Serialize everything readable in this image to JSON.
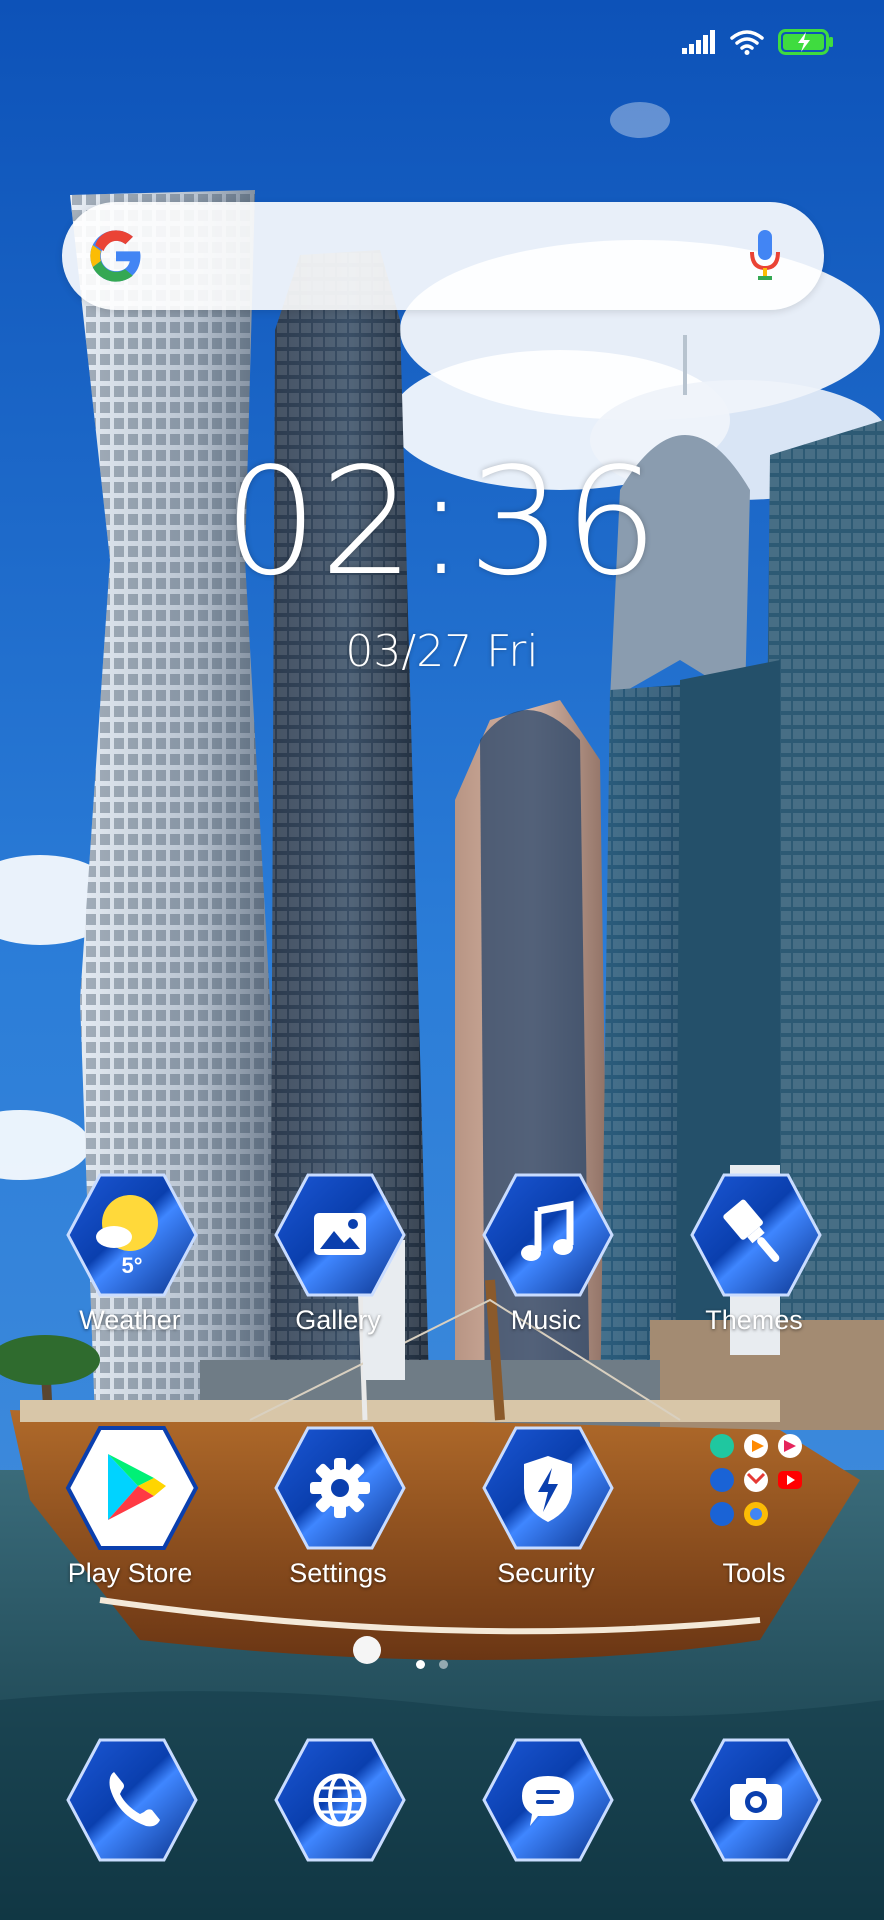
{
  "status_bar": {
    "icons": [
      "signal-icon",
      "wifi-icon",
      "battery-charging-icon"
    ],
    "battery_color": "#3fdc3f"
  },
  "search": {
    "icons": [
      "google-logo-icon",
      "microphone-icon"
    ]
  },
  "clock": {
    "time": "02:36",
    "date": "03/27 Fri"
  },
  "apps": {
    "row1": [
      {
        "label": "Weather",
        "icon": "weather-sun-icon",
        "temp": "5°"
      },
      {
        "label": "Gallery",
        "icon": "gallery-icon"
      },
      {
        "label": "Music",
        "icon": "music-note-icon"
      },
      {
        "label": "Themes",
        "icon": "paintbrush-icon"
      }
    ],
    "row2": [
      {
        "label": "Play Store",
        "icon": "play-store-icon"
      },
      {
        "label": "Settings",
        "icon": "gear-icon"
      },
      {
        "label": "Security",
        "icon": "shield-icon"
      },
      {
        "label": "Tools",
        "icon": "folder-grid-icon"
      }
    ]
  },
  "pager": {
    "pages": 2,
    "current": 1
  },
  "dock": [
    {
      "icon": "phone-icon"
    },
    {
      "icon": "browser-globe-icon"
    },
    {
      "icon": "messages-icon"
    },
    {
      "icon": "camera-icon"
    }
  ],
  "colors": {
    "icon_blue_dark": "#0a3a9e",
    "icon_blue_light": "#3f86ff",
    "sky": "#1f6fd1"
  }
}
